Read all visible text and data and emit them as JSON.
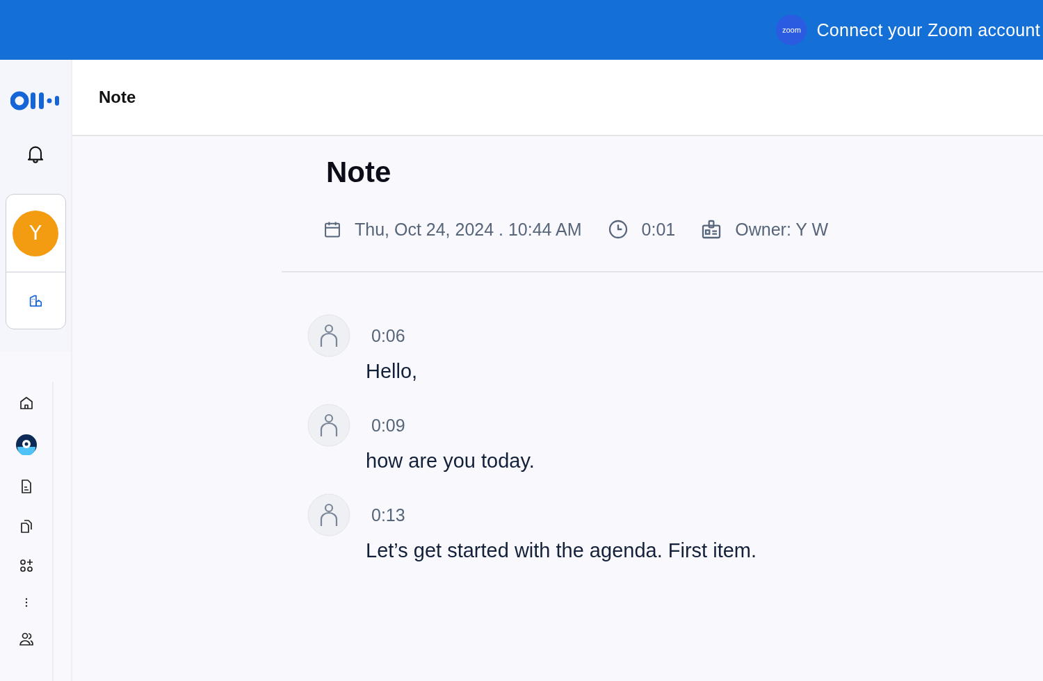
{
  "banner": {
    "logo_text": "zoom",
    "text": "Connect your Zoom account"
  },
  "sidebar": {
    "avatar_initial": "Y"
  },
  "header": {
    "title": "Note"
  },
  "note": {
    "title": "Note",
    "date": "Thu, Oct 24, 2024 . 10:44 AM",
    "duration": "0:01",
    "owner": "Owner: Y W"
  },
  "transcript": [
    {
      "time": "0:06",
      "text": "Hello,"
    },
    {
      "time": "0:09",
      "text": "how are you today."
    },
    {
      "time": "0:13",
      "text": "Let’s get started with the agenda. First item."
    }
  ]
}
